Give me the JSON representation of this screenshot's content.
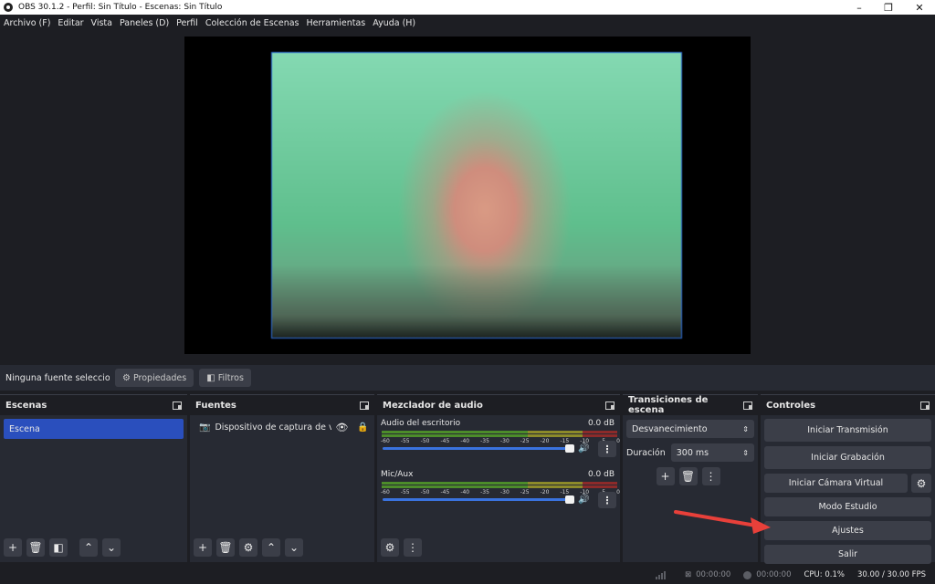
{
  "window": {
    "title": "OBS 30.1.2 - Perfil: Sin Título - Escenas: Sin Título",
    "minimize": "–",
    "restore": "❐",
    "close": "✕"
  },
  "menu": [
    "Archivo (F)",
    "Editar",
    "Vista",
    "Paneles (D)",
    "Perfil",
    "Colección de Escenas",
    "Herramientas",
    "Ayuda (H)"
  ],
  "source_toolbar": {
    "no_source": "Ninguna fuente seleccionada",
    "properties": "Propiedades",
    "filters": "Filtros"
  },
  "scenes": {
    "title": "Escenas",
    "items": [
      "Escena"
    ]
  },
  "sources": {
    "title": "Fuentes",
    "items": [
      "Dispositivo de captura de video"
    ]
  },
  "mixer": {
    "title": "Mezclador de audio",
    "ticks": [
      "-60",
      "-55",
      "-50",
      "-45",
      "-40",
      "-35",
      "-30",
      "-25",
      "-20",
      "-15",
      "-10",
      "-5",
      "0"
    ],
    "channels": [
      {
        "name": "Audio del escritorio",
        "db": "0.0 dB",
        "level": 1.0
      },
      {
        "name": "Mic/Aux",
        "db": "0.0 dB",
        "level": 1.0
      }
    ]
  },
  "transitions": {
    "title": "Transiciones de escena",
    "selected": "Desvanecimiento",
    "duration_label": "Duración",
    "duration_value": "300 ms"
  },
  "controls": {
    "title": "Controles",
    "start_stream": "Iniciar Transmisión",
    "start_record": "Iniciar Grabación",
    "virtual_cam": "Iniciar Cámara Virtual",
    "studio_mode": "Modo Estudio",
    "settings": "Ajustes",
    "exit": "Salir"
  },
  "status": {
    "live_time": "00:00:00",
    "rec_time": "00:00:00",
    "cpu": "CPU: 0.1%",
    "fps": "30.00 / 30.00 FPS"
  },
  "annotation_color": "#e8403a",
  "accent_color": "#2a4fbd"
}
